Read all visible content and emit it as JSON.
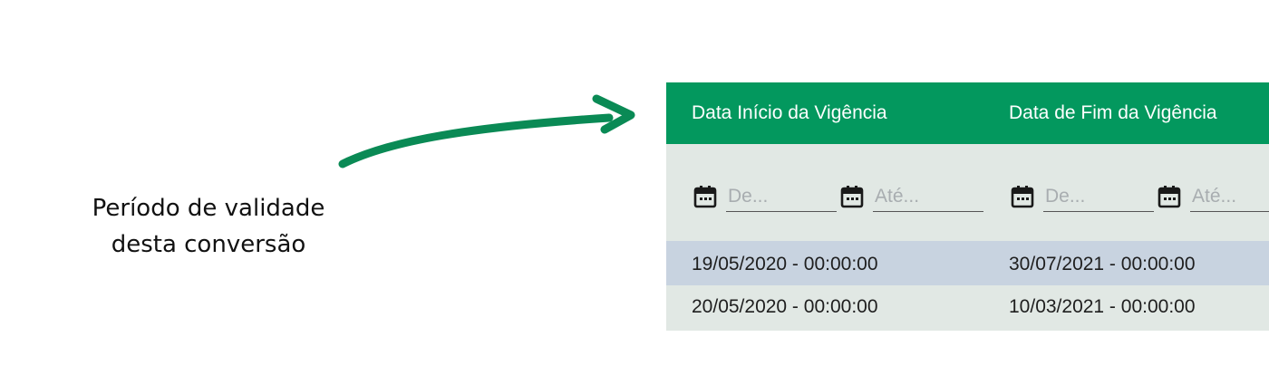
{
  "annotation": {
    "line1": "Período de validade",
    "line2": "desta conversão"
  },
  "colors": {
    "header_green": "#03985e",
    "arrow_green": "#0a8a55",
    "filter_bg": "#e1e8e4",
    "row_selected": "#c8d3e0",
    "row_normal": "#e1e8e4"
  },
  "grid": {
    "columns": [
      {
        "title": "Data Início da Vigência"
      },
      {
        "title": "Data de Fim da Vigência"
      }
    ],
    "filters": [
      {
        "from_placeholder": "De...",
        "to_placeholder": "Até..."
      },
      {
        "from_placeholder": "De...",
        "to_placeholder": "Até..."
      }
    ],
    "rows": [
      {
        "inicio": "19/05/2020 - 00:00:00",
        "fim": "30/07/2021 - 00:00:00"
      },
      {
        "inicio": "20/05/2020 - 00:00:00",
        "fim": "10/03/2021 - 00:00:00"
      }
    ]
  },
  "icons": {
    "filter_icon": "calendar-icon",
    "pointer": "arrow-icon"
  }
}
